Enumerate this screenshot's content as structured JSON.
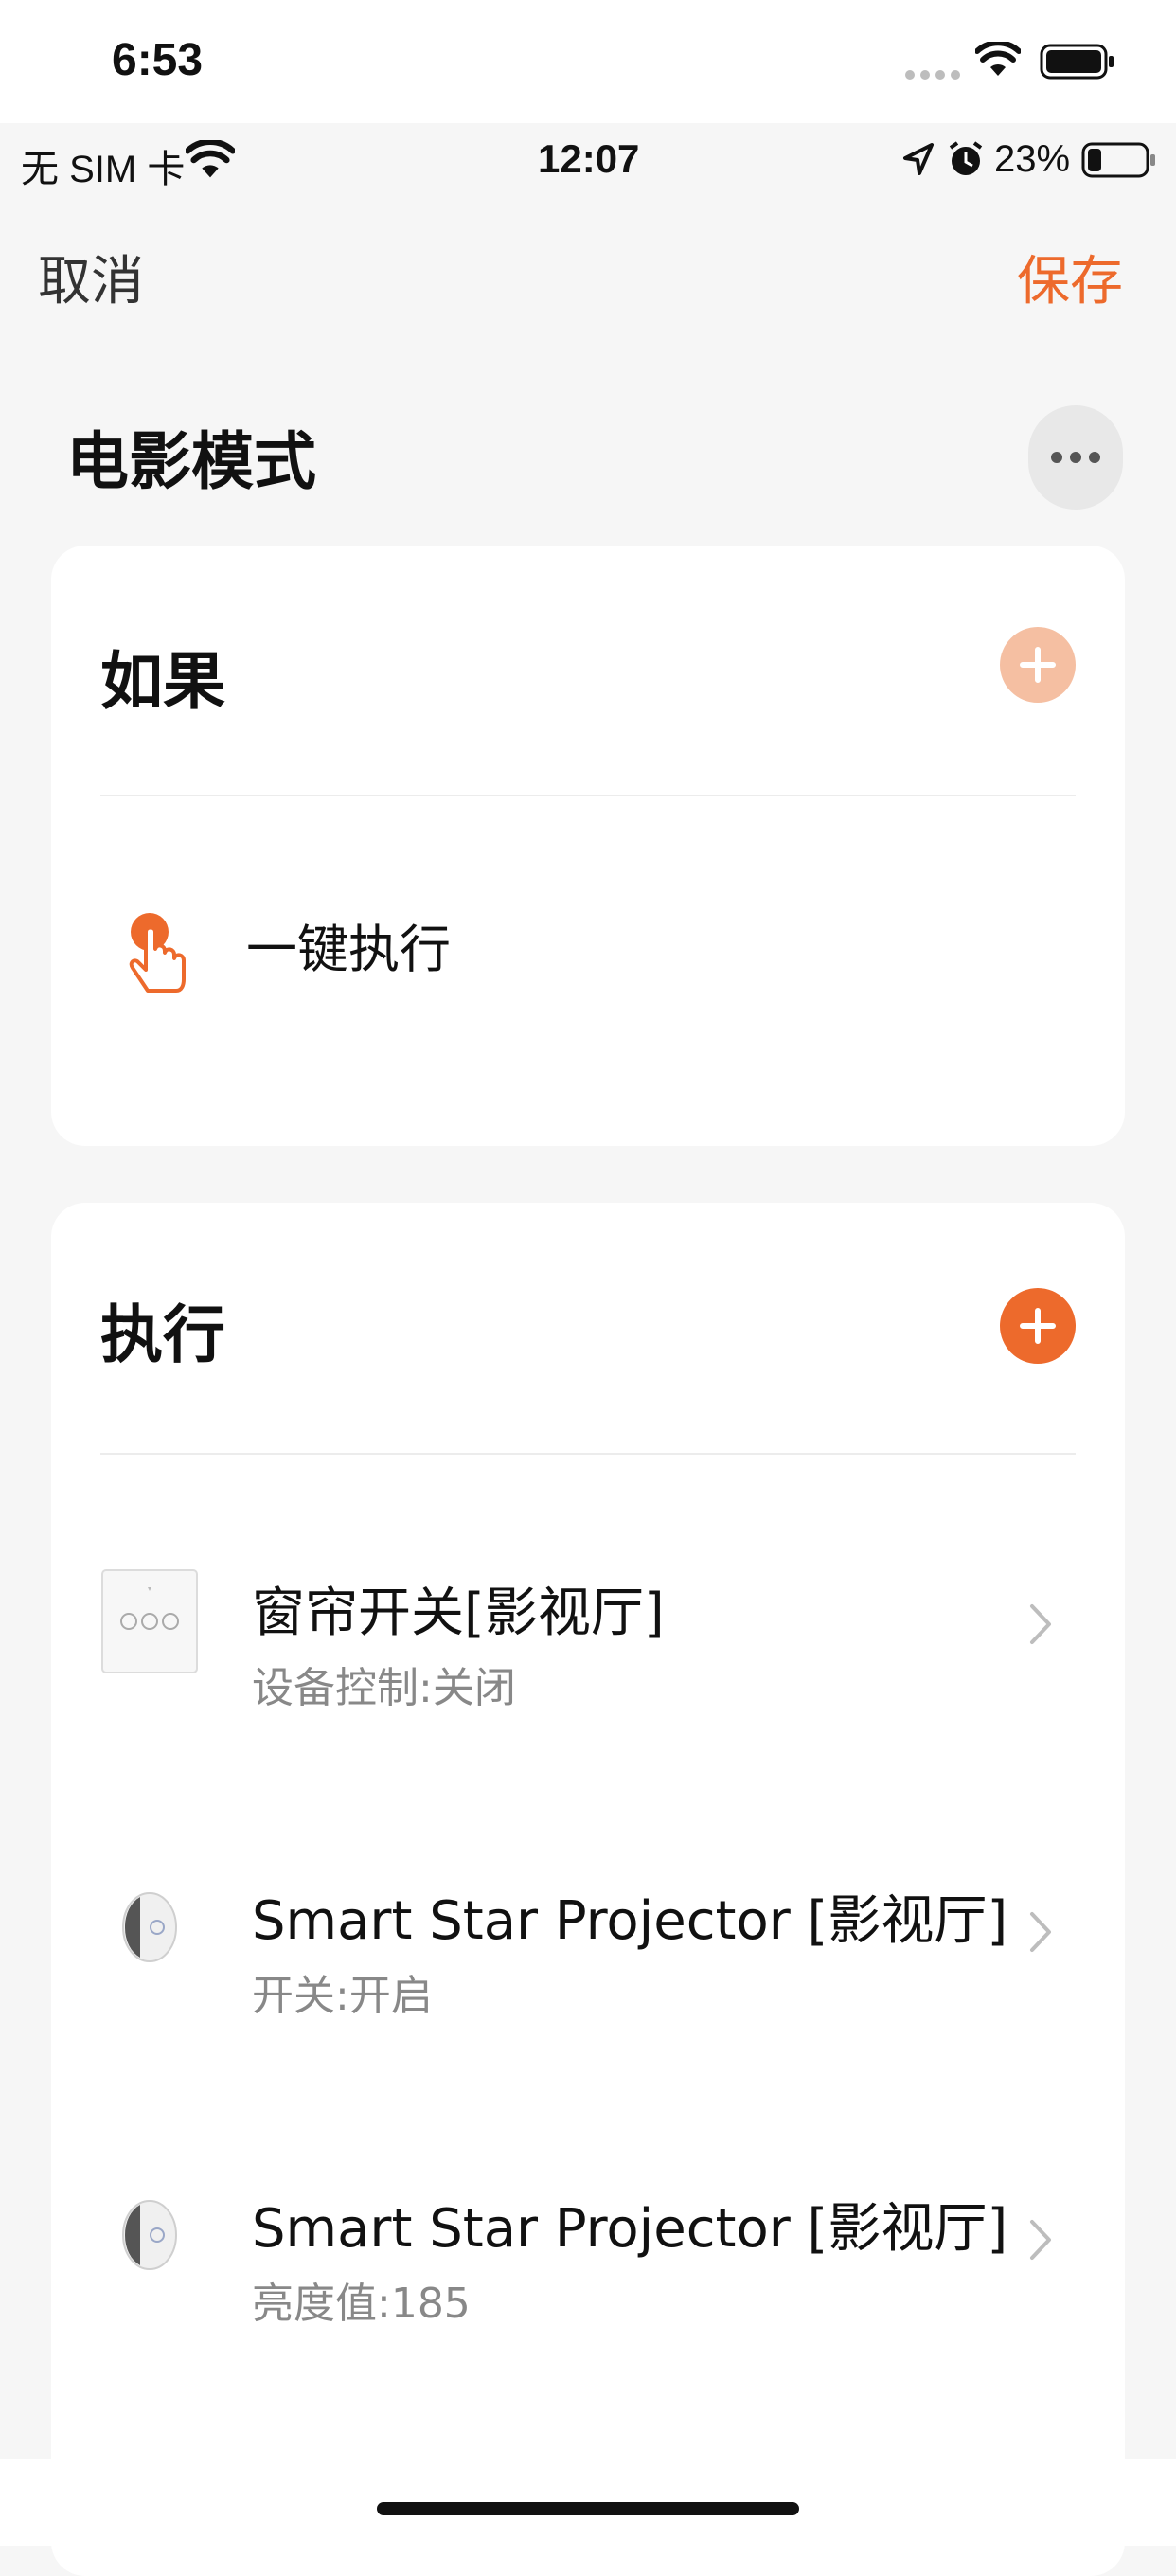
{
  "outer_status": {
    "time": "6:53"
  },
  "inner_status": {
    "carrier": "无 SIM 卡",
    "time": "12:07",
    "battery": "23%"
  },
  "nav": {
    "cancel_label": "取消",
    "save_label": "保存"
  },
  "scene": {
    "title": "电影模式"
  },
  "condition_section": {
    "title": "如果",
    "items": [
      {
        "label": "一键执行",
        "icon": "tap-hand-icon"
      }
    ]
  },
  "action_section": {
    "title": "执行",
    "items": [
      {
        "name": "窗帘开关[影视厅]",
        "detail": "设备控制:关闭",
        "icon": "curtain-switch-icon"
      },
      {
        "name": "Smart Star Projector [影视厅]",
        "detail": "开关:开启",
        "icon": "projector-icon"
      },
      {
        "name": "Smart Star Projector [影视厅]",
        "detail": "亮度值:185",
        "icon": "projector-icon"
      }
    ]
  },
  "colors": {
    "accent": "#ed6a2c",
    "accent_light": "#f5bfa2",
    "background": "#f6f6f6",
    "card": "#ffffff"
  }
}
